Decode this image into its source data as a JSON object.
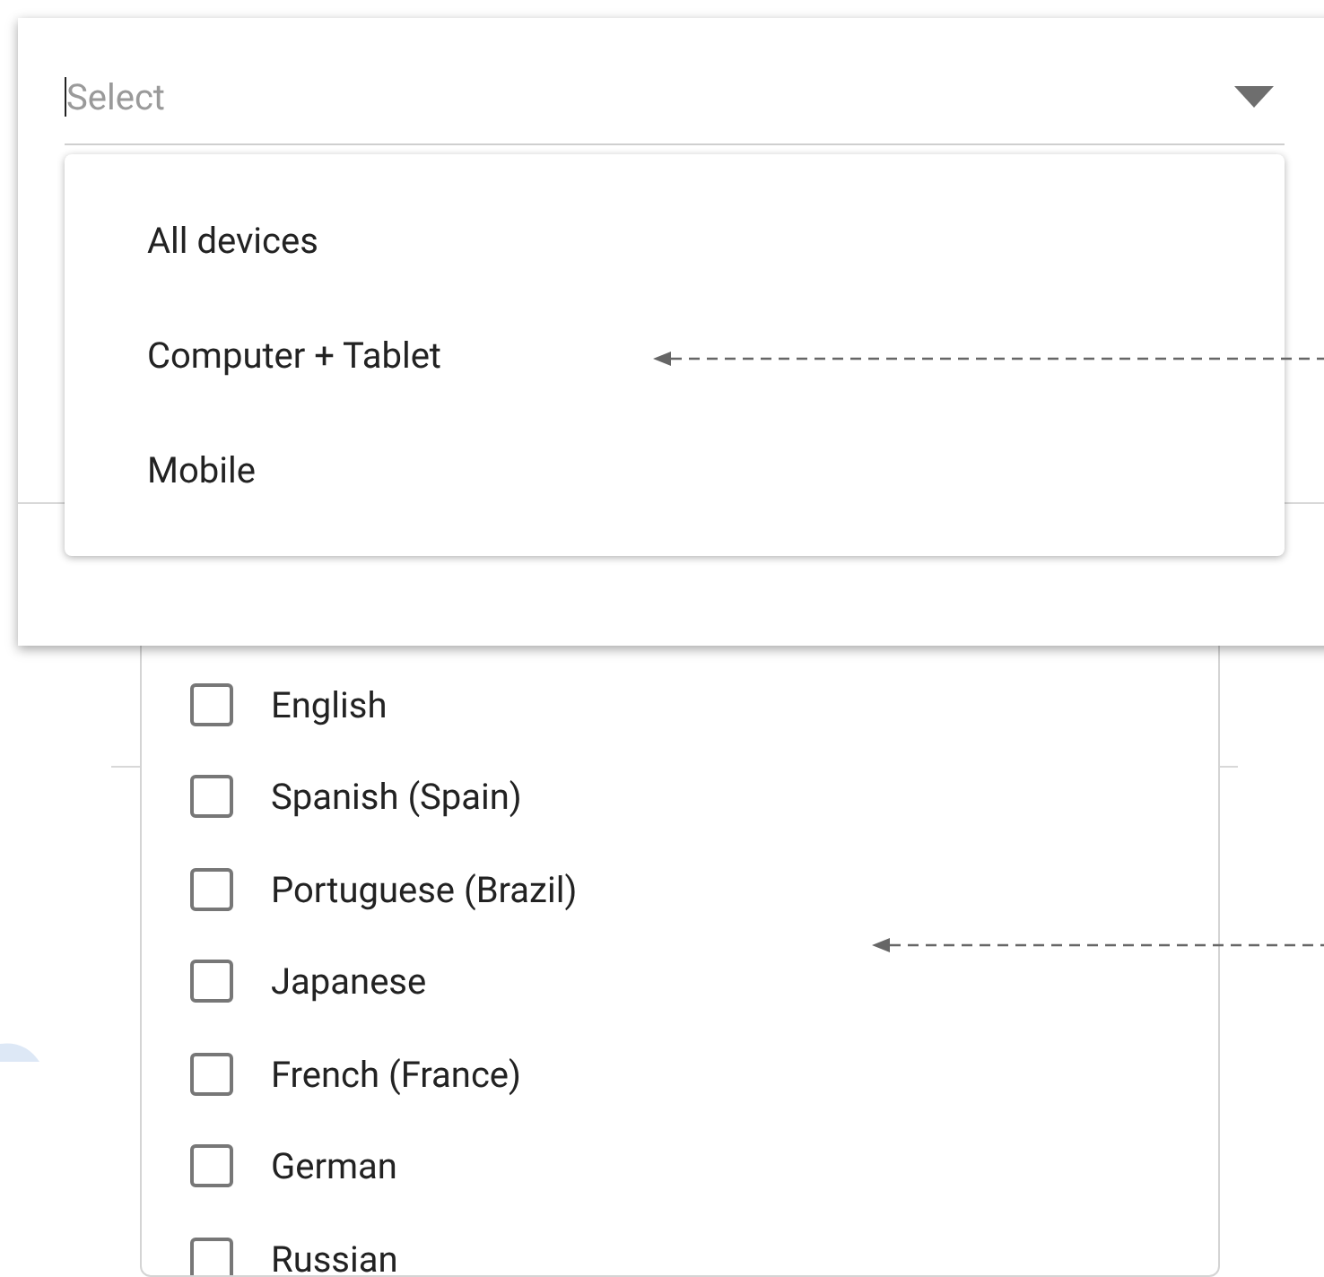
{
  "select": {
    "placeholder": "Select",
    "focused": true,
    "options": [
      {
        "label": "All devices"
      },
      {
        "label": "Computer + Tablet"
      },
      {
        "label": "Mobile"
      }
    ]
  },
  "languages": [
    {
      "label": "English",
      "checked": false
    },
    {
      "label": "Spanish (Spain)",
      "checked": false
    },
    {
      "label": "Portuguese (Brazil)",
      "checked": false
    },
    {
      "label": "Japanese",
      "checked": false
    },
    {
      "label": "French (France)",
      "checked": false
    },
    {
      "label": "German",
      "checked": false
    },
    {
      "label": "Russian",
      "checked": false
    }
  ]
}
